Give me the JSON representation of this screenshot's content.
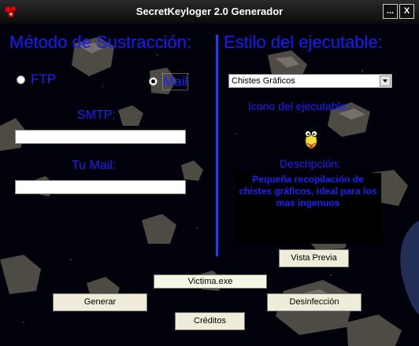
{
  "window": {
    "title": "SecretKeyloger 2.0 Generador",
    "min_label": "...",
    "close_label": "X"
  },
  "left": {
    "heading": "Método de Sustracción:",
    "radio_ftp": "FTP",
    "radio_mail": "Mail",
    "selected_method": "Mail",
    "smtp_label": "SMTP:",
    "smtp_value": "",
    "mail_label": "Tu Mail:",
    "mail_value": ""
  },
  "right": {
    "heading": "Estilo del ejecutable:",
    "style_selected": "Chistes Gráficos",
    "icon_label": "Icono del ejecutable:",
    "desc_label": "Descripción:",
    "description": "Pequeña recopilación de chistes gráficos, ideal para los mas ingenuos",
    "preview_button": "Vista Previa"
  },
  "bottom": {
    "filename": "Victima.exe",
    "generate_button": "Generar",
    "disinfect_button": "Desinfección",
    "credits_button": "Créditos"
  },
  "colors": {
    "accent": "#1f1fff",
    "background": "#00010a",
    "button": "#efedd9"
  }
}
